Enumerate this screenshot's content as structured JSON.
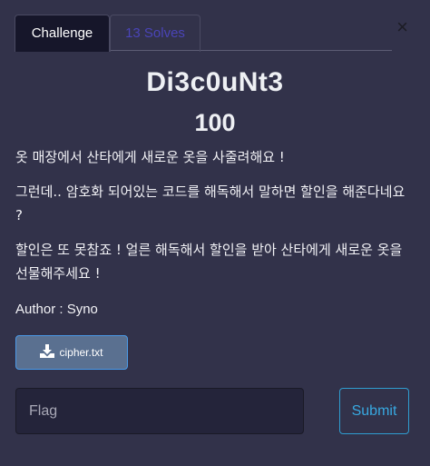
{
  "tabs": [
    {
      "label": "Challenge",
      "active": true
    },
    {
      "label": "13 Solves",
      "active": false
    }
  ],
  "close_label": "×",
  "challenge": {
    "name": "Di3c0uNt3",
    "points": "100",
    "description": [
      "옷 매장에서 산타에게 새로운 옷을 사줄려해요 !",
      "그런데.. 암호화 되어있는 코드를 해독해서 말하면 할인을 해준다네요 ?",
      "할인은 또 못참죠 ! 얼른 해독해서 할인을 받아 산타에게 새로운 옷을 선물해주세요 !"
    ],
    "author": "Author : Syno",
    "file": {
      "name": "cipher.txt",
      "icon": "download-icon"
    }
  },
  "flag": {
    "placeholder": "Flag",
    "value": ""
  },
  "submit_label": "Submit"
}
